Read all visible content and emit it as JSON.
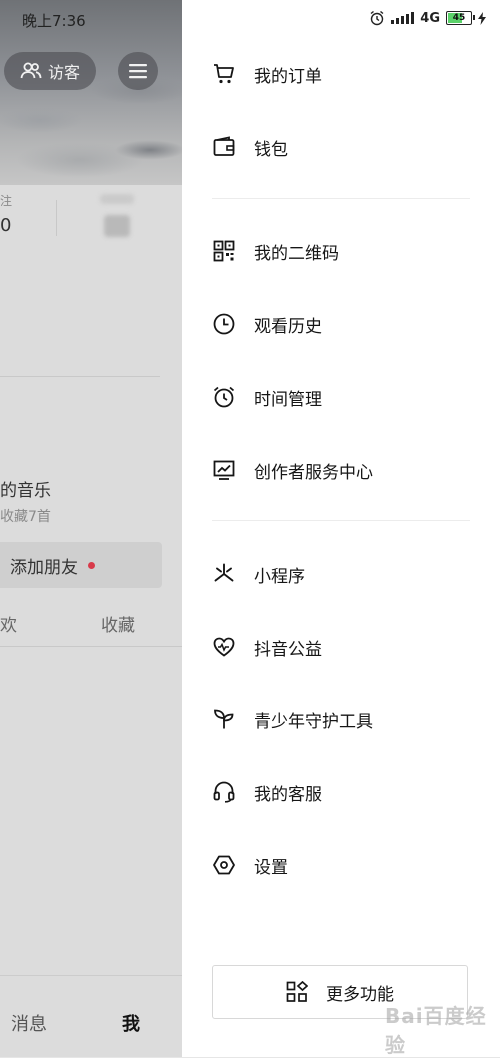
{
  "status": {
    "time": "晚上7:36",
    "network": "4G",
    "battery": "45"
  },
  "profile": {
    "visitor_label": "访客",
    "stat_left_label": "注",
    "stat_left_value": "0",
    "music_title": "的音乐",
    "music_sub": "收藏7首",
    "add_friend": "添加朋友",
    "tab_like": "欢",
    "tab_fav": "收藏",
    "nav_messages": "消息",
    "nav_me": "我"
  },
  "drawer": {
    "items": [
      {
        "label": "我的订单",
        "icon": "cart-icon"
      },
      {
        "label": "钱包",
        "icon": "wallet-icon"
      },
      {
        "label": "我的二维码",
        "icon": "qr-code-icon"
      },
      {
        "label": "观看历史",
        "icon": "clock-icon"
      },
      {
        "label": "时间管理",
        "icon": "alarm-icon"
      },
      {
        "label": "创作者服务中心",
        "icon": "chart-monitor-icon"
      },
      {
        "label": "小程序",
        "icon": "mini-program-icon"
      },
      {
        "label": "抖音公益",
        "icon": "heart-icon"
      },
      {
        "label": "青少年守护工具",
        "icon": "sprout-icon"
      },
      {
        "label": "我的客服",
        "icon": "headset-icon"
      },
      {
        "label": "设置",
        "icon": "settings-hexagon-icon"
      }
    ],
    "more_label": "更多功能"
  },
  "watermark": "Bai百度经验",
  "colors": {
    "drawer_bg": "#ffffff",
    "dim_bg": "#d9d9d9",
    "red_dot": "#d83a4a",
    "battery_fill": "#5bd26a"
  }
}
